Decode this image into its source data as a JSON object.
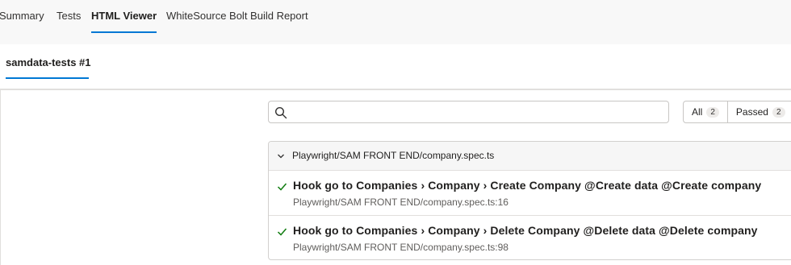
{
  "top_tabs": [
    "Summary",
    "Tests",
    "HTML Viewer",
    "WhiteSource Bolt Build Report"
  ],
  "active_top_tab": "HTML Viewer",
  "build_tab": "samdata-tests #1",
  "search": {
    "value": "",
    "placeholder": ""
  },
  "filters": [
    {
      "label": "All",
      "count": "2"
    },
    {
      "label": "Passed",
      "count": "2"
    }
  ],
  "file_group": {
    "title": "Playwright/SAM FRONT END/company.spec.ts",
    "tests": [
      {
        "name": "Hook go to Companies › Company › Create Company @Create data @Create company",
        "location": "Playwright/SAM FRONT END/company.spec.ts:16",
        "status": "passed"
      },
      {
        "name": "Hook go to Companies › Company › Delete Company @Delete data @Delete company",
        "location": "Playwright/SAM FRONT END/company.spec.ts:98",
        "status": "passed"
      }
    ]
  },
  "colors": {
    "accent": "#0078d4",
    "passed": "#107c10"
  },
  "icons": {
    "search": "search-icon",
    "chevron": "chevron-down-icon",
    "check": "check-icon"
  }
}
